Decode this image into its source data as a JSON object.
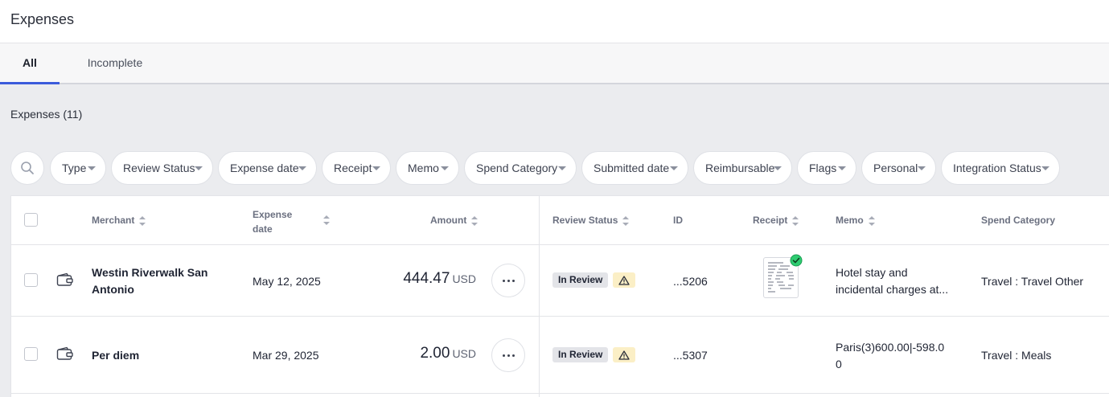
{
  "page": {
    "title": "Expenses"
  },
  "tabs": [
    {
      "label": "All",
      "active": true
    },
    {
      "label": "Incomplete",
      "active": false
    }
  ],
  "section": {
    "title": "Expenses (11)"
  },
  "filters": [
    "Type",
    "Review Status",
    "Expense date",
    "Receipt",
    "Memo",
    "Spend Category",
    "Submitted date",
    "Reimbursable",
    "Flags",
    "Personal",
    "Integration Status"
  ],
  "columns": {
    "merchant": "Merchant",
    "expense_date_line1": "Expense",
    "expense_date_line2": "date",
    "amount": "Amount",
    "review_status": "Review Status",
    "id": "ID",
    "receipt": "Receipt",
    "memo": "Memo",
    "spend_category": "Spend Category"
  },
  "rows": [
    {
      "merchant_line1": "Westin Riverwalk San",
      "merchant_line2": "Antonio",
      "date": "May 12, 2025",
      "amount": "444.47",
      "currency": "USD",
      "review_status": "In Review",
      "id": "...5206",
      "memo_line1": "Hotel stay and",
      "memo_line2": "incidental charges at...",
      "spend_category": "Travel : Travel Other",
      "has_receipt": true
    },
    {
      "merchant_line1": "Per diem",
      "merchant_line2": "",
      "date": "Mar 29, 2025",
      "amount": "2.00",
      "currency": "USD",
      "review_status": "In Review",
      "id": "...5307",
      "memo_line1": "Paris(3)600.00|-598.0",
      "memo_line2": "0",
      "spend_category": "Travel : Meals",
      "has_receipt": false
    }
  ],
  "colors": {
    "accent": "#3b5bdb",
    "warning_bg": "#fbefc6",
    "receipt_check": "#2ecc71"
  }
}
